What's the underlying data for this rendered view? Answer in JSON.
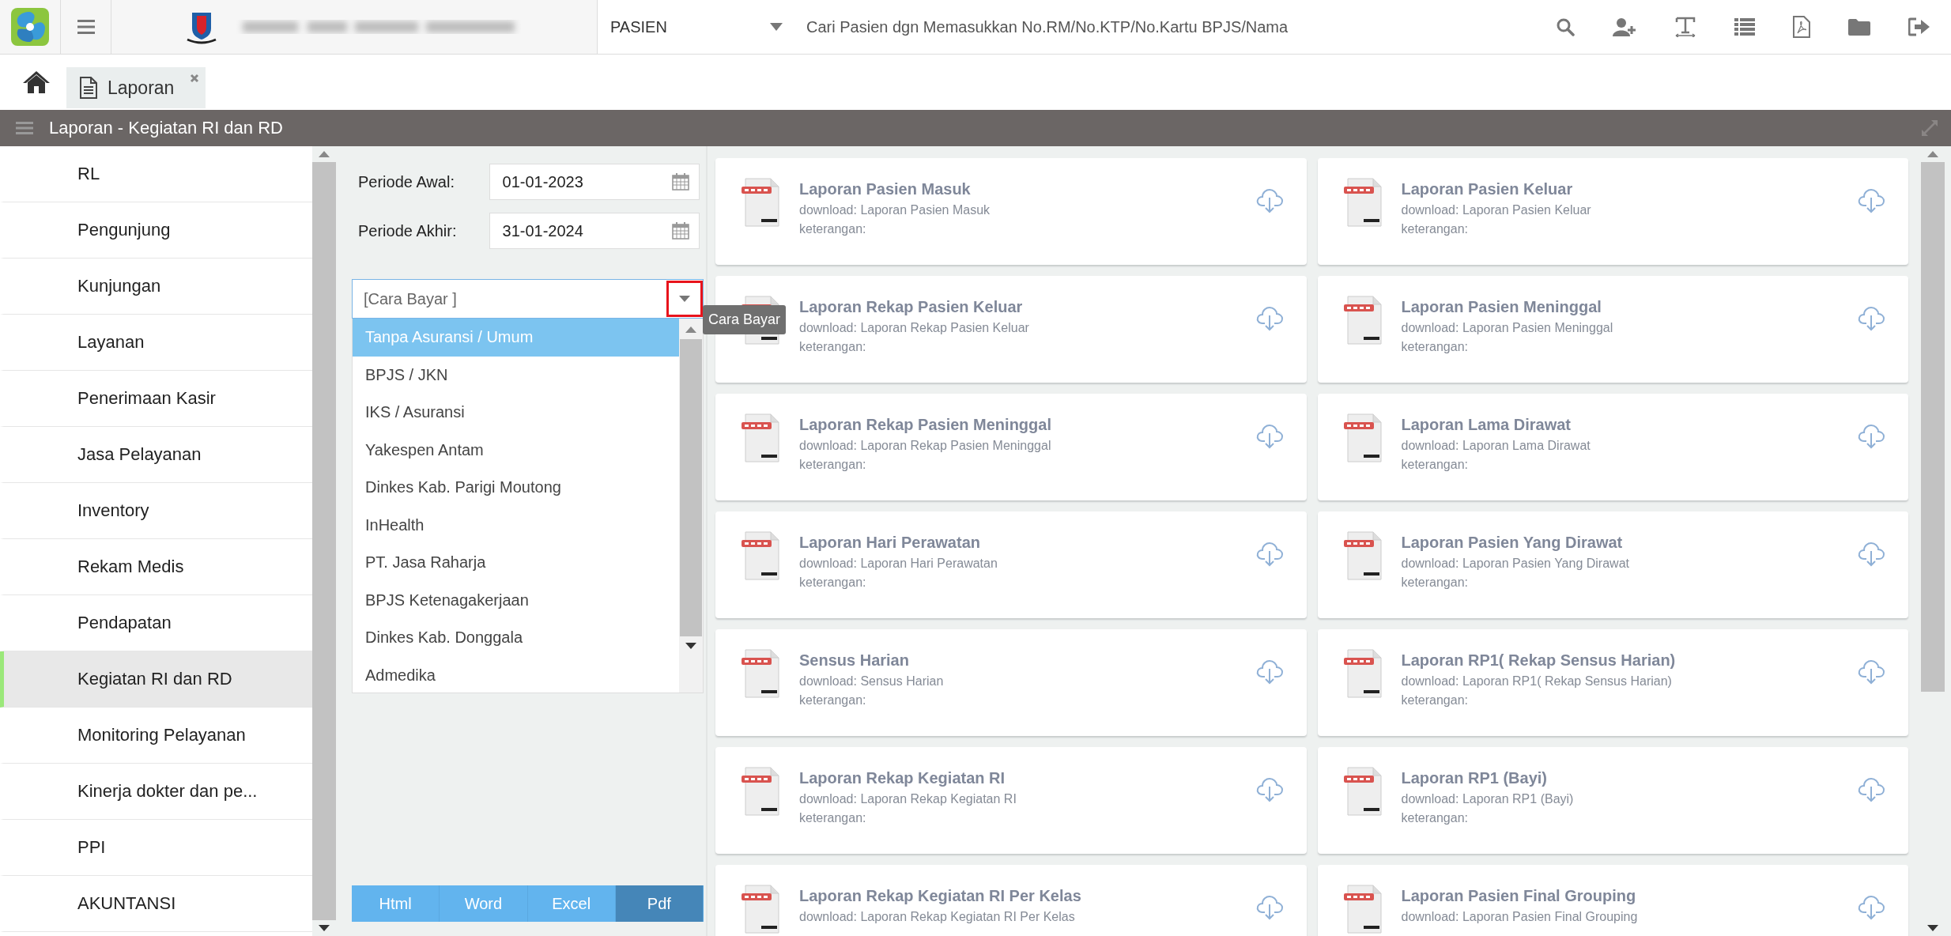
{
  "top_bar": {
    "search_category": "PASIEN",
    "search_placeholder": "Cari Pasien dgn Memasukkan No.RM/No.KTP/No.Kartu BPJS/Nama"
  },
  "tabs": [
    {
      "label": "Laporan",
      "selected": true
    }
  ],
  "panel": {
    "title": "Laporan - Kegiatan RI dan RD"
  },
  "sidebar": {
    "items": [
      {
        "label": "RL",
        "selected": false
      },
      {
        "label": "Pengunjung",
        "selected": false
      },
      {
        "label": "Kunjungan",
        "selected": false
      },
      {
        "label": "Layanan",
        "selected": false
      },
      {
        "label": "Penerimaan Kasir",
        "selected": false
      },
      {
        "label": "Jasa Pelayanan",
        "selected": false
      },
      {
        "label": "Inventory",
        "selected": false
      },
      {
        "label": "Rekam Medis",
        "selected": false
      },
      {
        "label": "Pendapatan",
        "selected": false
      },
      {
        "label": "Kegiatan RI dan RD",
        "selected": true
      },
      {
        "label": "Monitoring Pelayanan",
        "selected": false
      },
      {
        "label": "Kinerja dokter dan pe...",
        "selected": false
      },
      {
        "label": "PPI",
        "selected": false
      },
      {
        "label": "AKUNTANSI",
        "selected": false
      }
    ]
  },
  "form": {
    "fields": [
      {
        "label": "Periode Awal:",
        "value": "01-01-2023"
      },
      {
        "label": "Periode Akhir:",
        "value": "31-01-2024"
      }
    ],
    "dropdown": {
      "placeholder": "[Cara Bayar ]",
      "highlighted": true,
      "tooltip": "Cara Bayar",
      "options": [
        {
          "label": "Tanpa Asuransi / Umum",
          "selected": true
        },
        {
          "label": "BPJS / JKN",
          "selected": false
        },
        {
          "label": "IKS / Asuransi",
          "selected": false
        },
        {
          "label": "Yakespen Antam",
          "selected": false
        },
        {
          "label": "Dinkes Kab. Parigi Moutong",
          "selected": false
        },
        {
          "label": "InHealth",
          "selected": false
        },
        {
          "label": "PT. Jasa Raharja",
          "selected": false
        },
        {
          "label": "BPJS Ketenagakerjaan",
          "selected": false
        },
        {
          "label": "Dinkes Kab. Donggala",
          "selected": false
        },
        {
          "label": "Admedika",
          "selected": false
        }
      ]
    },
    "export_buttons": [
      {
        "label": "Html",
        "selected": false
      },
      {
        "label": "Word",
        "selected": false
      },
      {
        "label": "Excel",
        "selected": false
      },
      {
        "label": "Pdf",
        "selected": true
      }
    ]
  },
  "reports": [
    {
      "title": "Laporan Pasien Masuk",
      "download": "download: Laporan Pasien Masuk",
      "note": "keterangan:"
    },
    {
      "title": "Laporan Pasien Keluar",
      "download": "download: Laporan Pasien Keluar",
      "note": "keterangan:"
    },
    {
      "title": "Laporan Rekap Pasien Keluar",
      "download": "download: Laporan Rekap Pasien Keluar",
      "note": "keterangan:"
    },
    {
      "title": "Laporan Pasien Meninggal",
      "download": "download: Laporan Pasien Meninggal",
      "note": "keterangan:"
    },
    {
      "title": "Laporan Rekap Pasien Meninggal",
      "download": "download: Laporan Rekap Pasien Meninggal",
      "note": "keterangan:"
    },
    {
      "title": "Laporan Lama Dirawat",
      "download": "download: Laporan Lama Dirawat",
      "note": "keterangan:"
    },
    {
      "title": "Laporan Hari Perawatan",
      "download": "download: Laporan Hari Perawatan",
      "note": "keterangan:"
    },
    {
      "title": "Laporan Pasien Yang Dirawat",
      "download": "download: Laporan Pasien Yang Dirawat",
      "note": "keterangan:"
    },
    {
      "title": "Sensus Harian",
      "download": "download: Sensus Harian",
      "note": "keterangan:"
    },
    {
      "title": "Laporan RP1( Rekap Sensus Harian)",
      "download": "download: Laporan RP1( Rekap Sensus Harian)",
      "note": "keterangan:"
    },
    {
      "title": "Laporan Rekap Kegiatan RI",
      "download": "download: Laporan Rekap Kegiatan RI",
      "note": "keterangan:"
    },
    {
      "title": "Laporan RP1 (Bayi)",
      "download": "download: Laporan RP1 (Bayi)",
      "note": "keterangan:"
    },
    {
      "title": "Laporan Rekap Kegiatan RI Per Kelas",
      "download": "download: Laporan Rekap Kegiatan RI Per Kelas"
    },
    {
      "title": "Laporan Pasien Final Grouping",
      "download": "download: Laporan Pasien Final Grouping"
    }
  ]
}
